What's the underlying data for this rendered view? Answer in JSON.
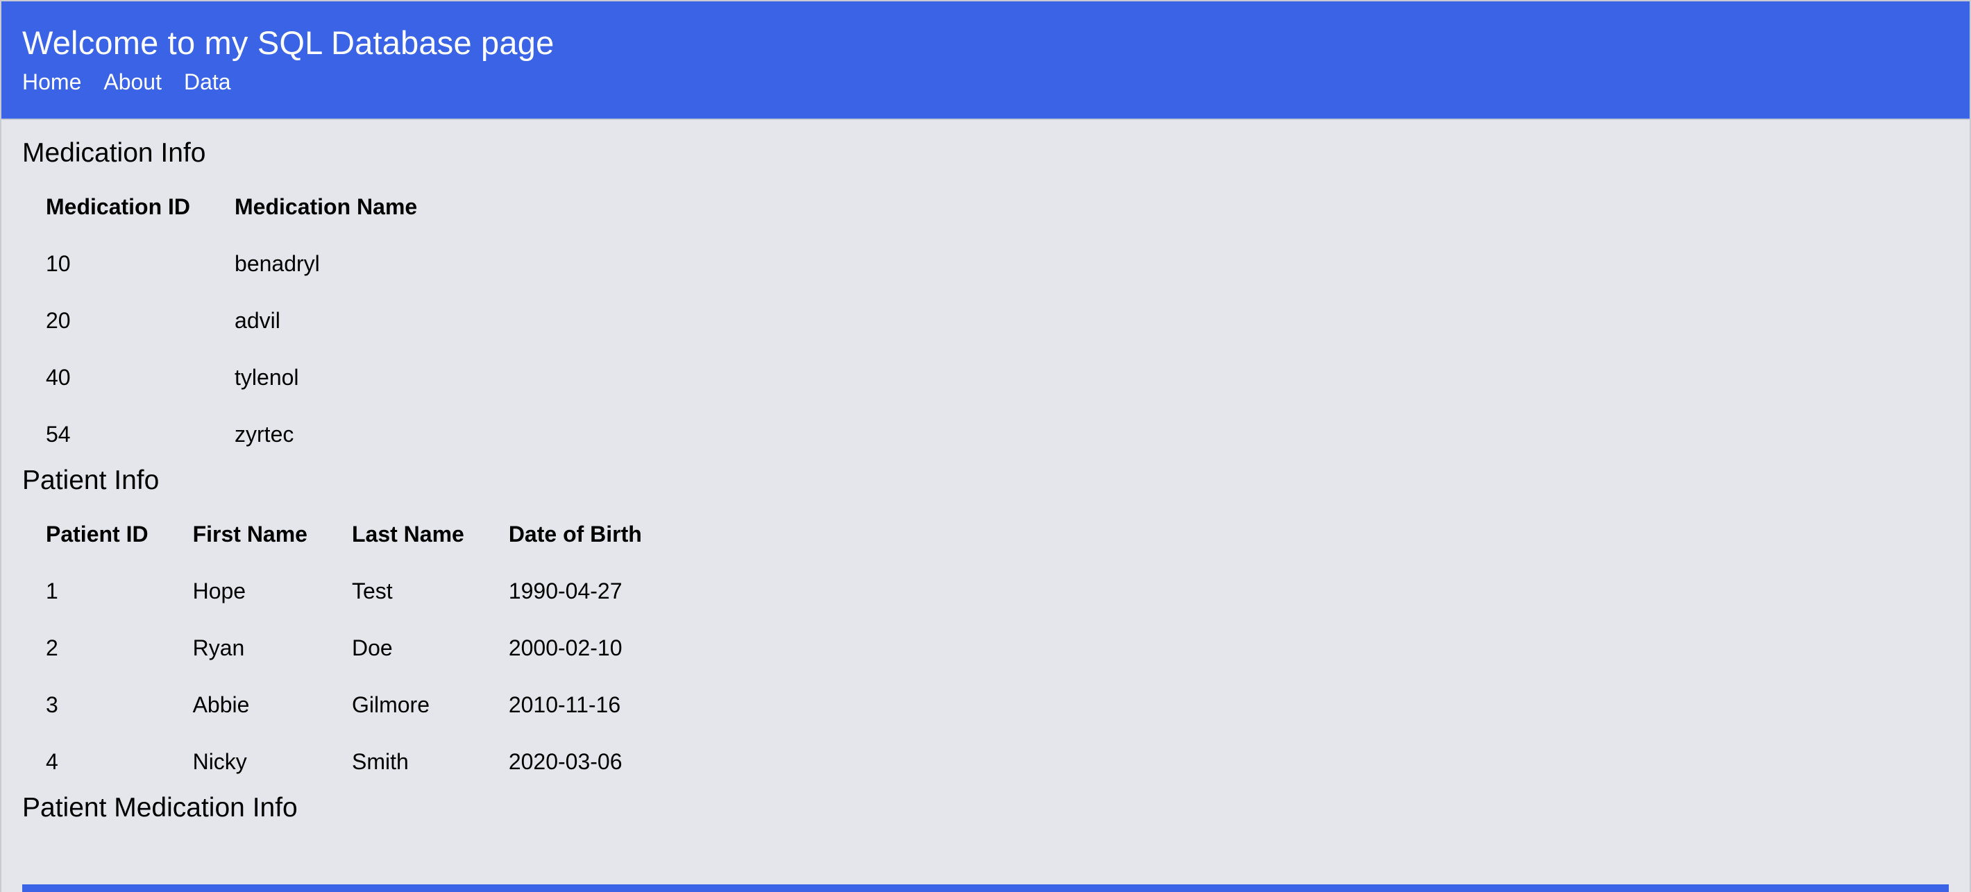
{
  "header": {
    "title": "Welcome to my SQL Database page",
    "nav": [
      "Home",
      "About",
      "Data"
    ]
  },
  "medication_section": {
    "title": "Medication Info",
    "columns": [
      "Medication ID",
      "Medication Name"
    ],
    "rows": [
      [
        "10",
        "benadryl"
      ],
      [
        "20",
        "advil"
      ],
      [
        "40",
        "tylenol"
      ],
      [
        "54",
        "zyrtec"
      ]
    ]
  },
  "patient_section": {
    "title": "Patient Info",
    "columns": [
      "Patient ID",
      "First Name",
      "Last Name",
      "Date of Birth"
    ],
    "rows": [
      [
        "1",
        "Hope",
        "Test",
        "1990-04-27"
      ],
      [
        "2",
        "Ryan",
        "Doe",
        "2000-02-10"
      ],
      [
        "3",
        "Abbie",
        "Gilmore",
        "2010-11-16"
      ],
      [
        "4",
        "Nicky",
        "Smith",
        "2020-03-06"
      ]
    ]
  },
  "patient_medication_section": {
    "title": "Patient Medication Info"
  },
  "colors": {
    "header_bg": "#3b63e5",
    "page_bg": "#e5e6eb",
    "header_text": "#ffffff"
  }
}
